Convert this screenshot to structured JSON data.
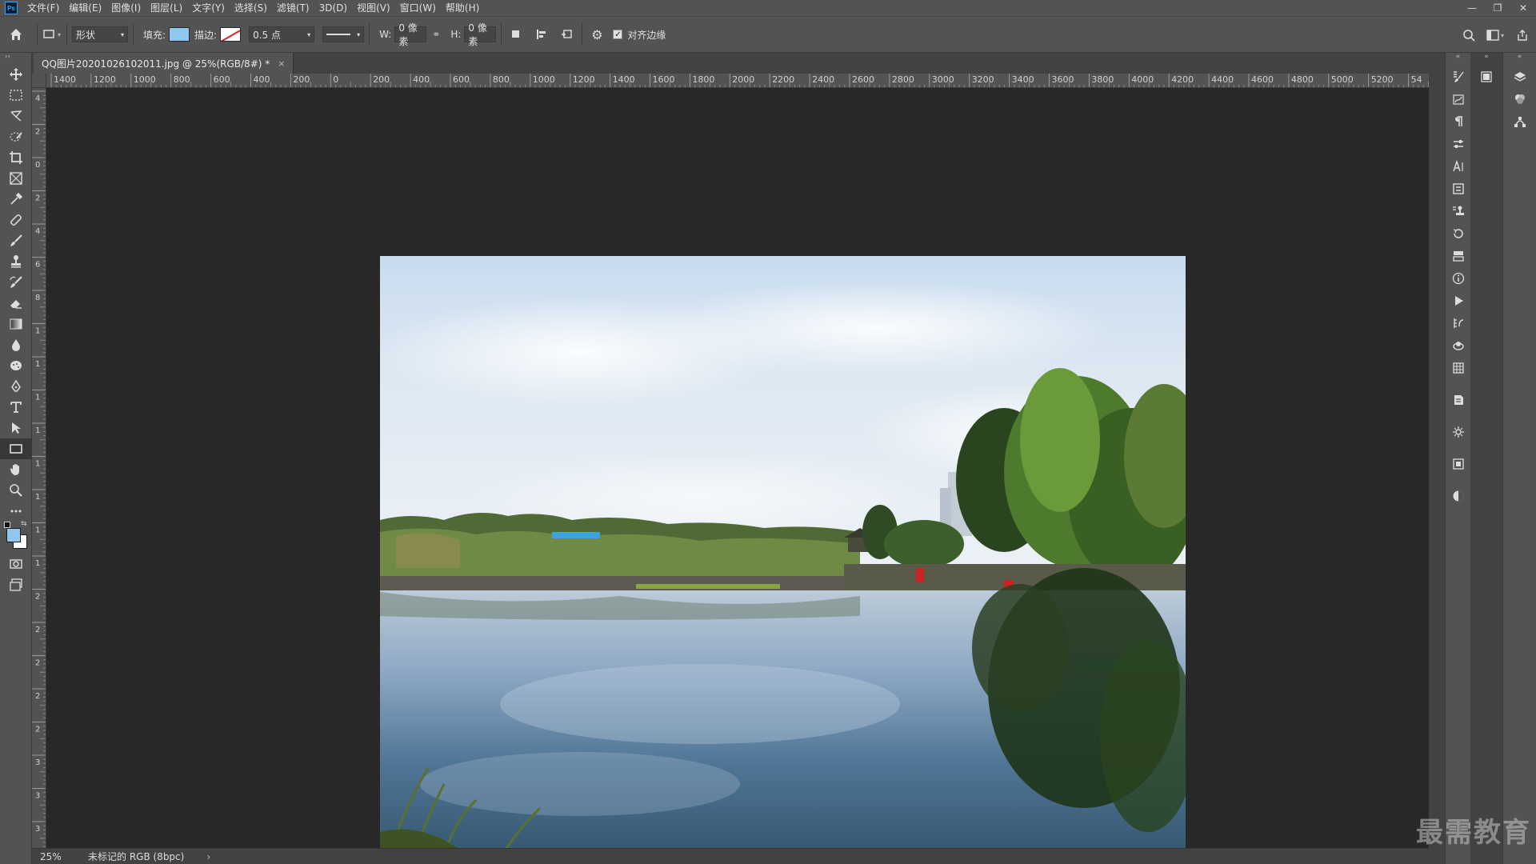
{
  "app": {
    "logo": "Ps"
  },
  "menu": [
    "文件(F)",
    "编辑(E)",
    "图像(I)",
    "图层(L)",
    "文字(Y)",
    "选择(S)",
    "滤镜(T)",
    "3D(D)",
    "视图(V)",
    "窗口(W)",
    "帮助(H)"
  ],
  "options": {
    "mode_select": "形状",
    "fill_label": "填充:",
    "fill_color": "#8ec8ef",
    "stroke_label": "描边:",
    "stroke_width": "0.5 点",
    "w_label": "W:",
    "w_value": "0 像素",
    "h_label": "H:",
    "h_value": "0 像素",
    "align_edges_label": "对齐边缘",
    "align_edges_checked": true
  },
  "document": {
    "tab_title": "QQ图片20201026102011.jpg @ 25%(RGB/8#) *",
    "close": "×"
  },
  "ruler_h_labels": [
    "1400",
    "1200",
    "1000",
    "800",
    "600",
    "400",
    "200",
    "0",
    "200",
    "400",
    "600",
    "800",
    "1000",
    "1200",
    "1400",
    "1600",
    "1800",
    "2000",
    "2200",
    "2400",
    "2600",
    "2800",
    "3000",
    "3200",
    "3400",
    "3600",
    "3800",
    "4000",
    "4200",
    "4400",
    "4600",
    "4800",
    "5000",
    "5200",
    "54"
  ],
  "ruler_v_labels": [
    "4",
    "2",
    "0",
    "2",
    "4",
    "6",
    "8",
    "1",
    "1",
    "1",
    "1",
    "1",
    "1",
    "1",
    "1",
    "2",
    "2",
    "2",
    "2",
    "2",
    "3",
    "3",
    "3"
  ],
  "status": {
    "zoom": "25%",
    "info": "未标记的 RGB (8bpc)",
    "arrow": "›"
  },
  "watermark": "最需教育",
  "colors": {
    "foreground": "#8ec8ef",
    "background": "#ffffff"
  }
}
